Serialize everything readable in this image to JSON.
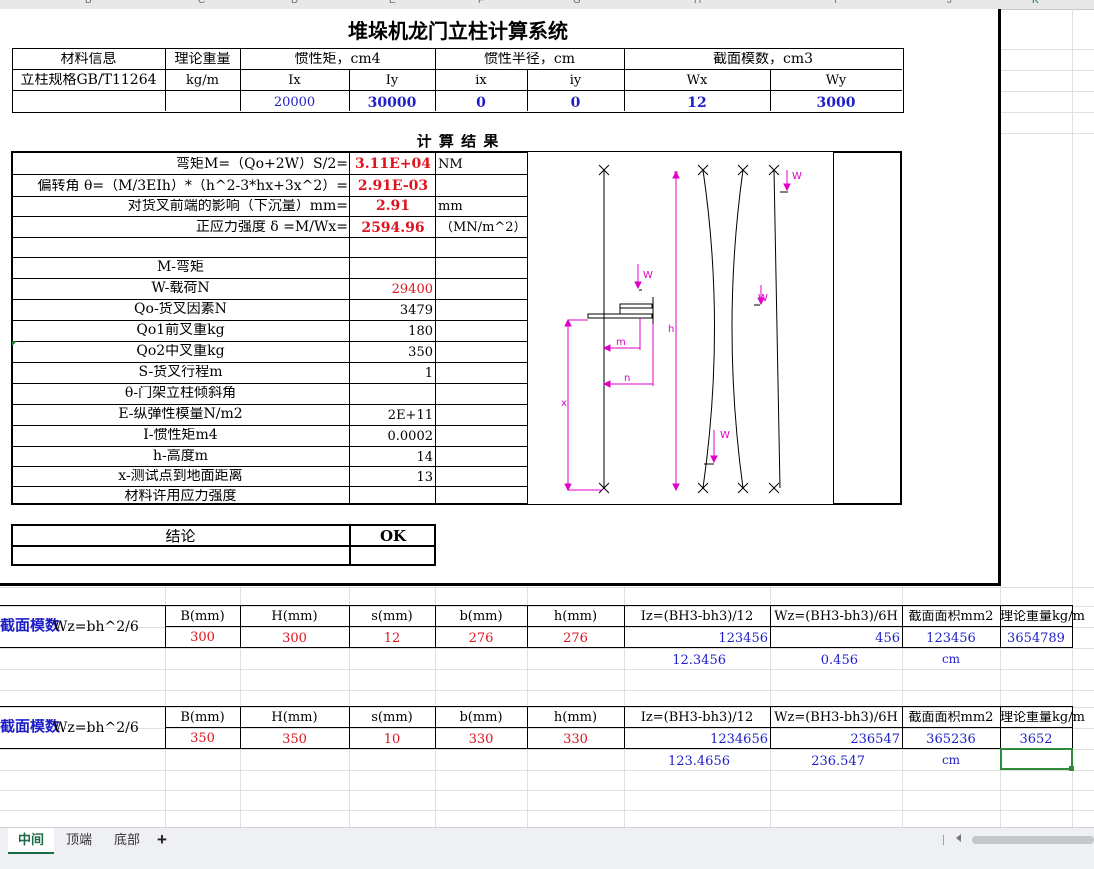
{
  "col_headers": [
    "B",
    "C",
    "D",
    "E",
    "F",
    "G",
    "H",
    "I",
    "J",
    "K"
  ],
  "title": "堆垛机龙门立柱计算系统",
  "spec": {
    "h_material": "材料信息",
    "h_weight": "理论重量",
    "h_inertia": "惯性矩，cm4",
    "h_radius": "惯性半径，cm",
    "h_modulus": "截面模数，cm3",
    "sub_spec": "立柱规格GB/T11264",
    "sub_unit": "kg/m",
    "sub_ix": "Ix",
    "sub_iy": "Iy",
    "sub_rix": "ix",
    "sub_riy": "iy",
    "sub_wx": "Wx",
    "sub_wy": "Wy",
    "v_ix": "20000",
    "v_iy": "30000",
    "v_rix": "0",
    "v_riy": "0",
    "v_wx": "12",
    "v_wy": "3000"
  },
  "results": {
    "heading": "计 算 结 果",
    "r1_label": "弯矩M=（Qo+2W）S/2=",
    "r1_value": "3.11E+04",
    "r1_unit": "NM",
    "r2_label": "偏转角 θ=（M/3EIh）*（h^2-3*hx+3x^2）=",
    "r2_value": "2.91E-03",
    "r3_label": "对货叉前端的影响（下沉量）mm=",
    "r3_value": "2.91",
    "r3_unit": "mm",
    "r4_label": "正应力强度 δ =M/Wx=",
    "r4_value": "2594.96",
    "r4_unit": "（MN/m^2）"
  },
  "params": [
    {
      "label": "M-弯矩",
      "value": ""
    },
    {
      "label": "W-载荷N",
      "value": "29400"
    },
    {
      "label": "Qo-货叉因素N",
      "value": "3479"
    },
    {
      "label": "Qo1前叉重kg",
      "value": "180"
    },
    {
      "label": "Qo2中叉重kg",
      "value": "350"
    },
    {
      "label": "S-货叉行程m",
      "value": "1"
    },
    {
      "label": "θ-门架立柱倾斜角",
      "value": ""
    },
    {
      "label": "E-纵弹性模量N/m2",
      "value": "2E+11"
    },
    {
      "label": "I-惯性矩m4",
      "value": "0.0002"
    },
    {
      "label": "h-高度m",
      "value": "14"
    },
    {
      "label": "x-测试点到地面距离",
      "value": "13"
    },
    {
      "label": "材料许用应力强度",
      "value": ""
    }
  ],
  "diagram_labels": {
    "w": "W",
    "h": "h",
    "m": "m",
    "n": "n",
    "x": "x"
  },
  "conclusion": {
    "label": "结论",
    "value": "OK"
  },
  "section1": {
    "title": "截面模数",
    "formula": "Wz=bh^2/6",
    "headers": [
      "B(mm)",
      "H(mm)",
      "s(mm)",
      "b(mm)",
      "h(mm)",
      "Iz=(BH3-bh3)/12",
      "Wz=(BH3-bh3)/6H",
      "截面面积mm2",
      "理论重量kg/m"
    ],
    "values": [
      "300",
      "300",
      "12",
      "276",
      "276",
      "123456",
      "456",
      "123456",
      "3654789"
    ],
    "cm_iz": "12.3456",
    "cm_wz": "0.456",
    "cm_unit": "cm"
  },
  "section2": {
    "title": "截面模数",
    "formula": "Wz=bh^2/6",
    "headers": [
      "B(mm)",
      "H(mm)",
      "s(mm)",
      "b(mm)",
      "h(mm)",
      "Iz=(BH3-bh3)/12",
      "Wz=(BH3-bh3)/6H",
      "截面面积mm2",
      "理论重量kg/m"
    ],
    "values": [
      "350",
      "350",
      "10",
      "330",
      "330",
      "1234656",
      "236547",
      "365236",
      "3652"
    ],
    "cm_iz": "123.4656",
    "cm_wz": "236.547",
    "cm_unit": "cm"
  },
  "tabs": [
    "中间",
    "顶端",
    "底部"
  ],
  "add_tab": "+",
  "colors": {
    "accent_green": "#1a6b45",
    "value_blue": "#1f1fc8",
    "value_red": "#e0141e",
    "selection": "#2e8b3a"
  }
}
